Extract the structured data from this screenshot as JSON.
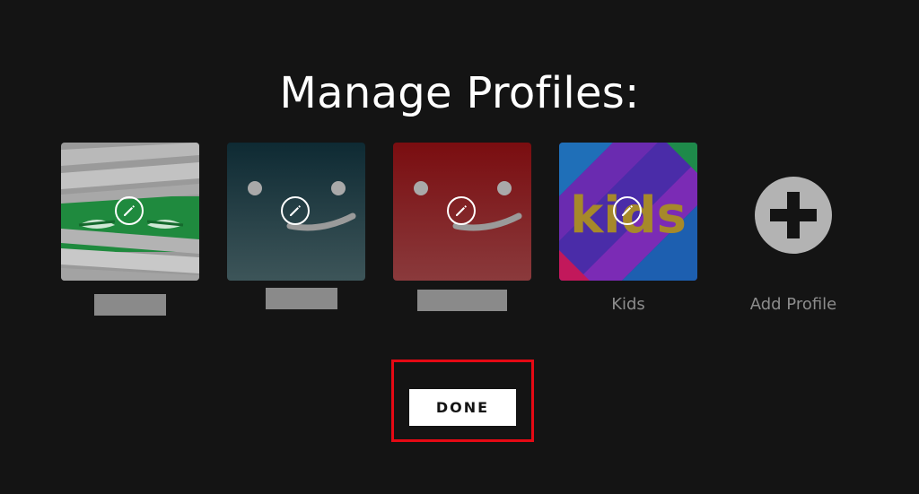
{
  "page": {
    "title": "Manage Profiles:"
  },
  "profiles": [
    {
      "name": "",
      "avatar": "mummy-green",
      "name_redacted": true
    },
    {
      "name": "",
      "avatar": "smiley-teal",
      "name_redacted": true
    },
    {
      "name": "",
      "avatar": "smiley-red",
      "name_redacted": true
    },
    {
      "name": "Kids",
      "avatar": "kids",
      "avatar_text": "kids",
      "name_redacted": false
    }
  ],
  "add_profile": {
    "label": "Add Profile",
    "icon": "plus-circle-icon"
  },
  "done_button": {
    "label": "DONE"
  },
  "colors": {
    "background": "#141414",
    "highlight": "#e50914",
    "muted_text": "#8c8c8c"
  }
}
